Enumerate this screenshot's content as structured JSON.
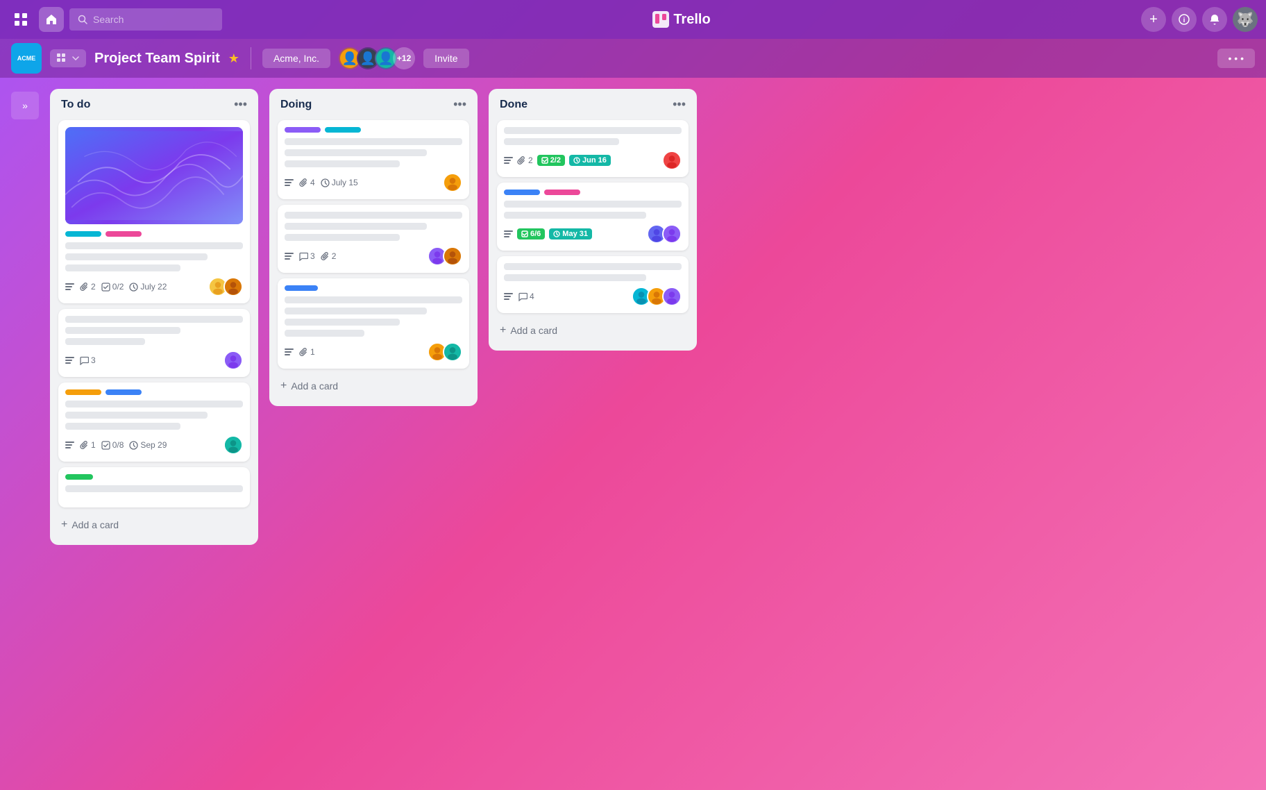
{
  "app": {
    "title": "Trello"
  },
  "nav": {
    "search_placeholder": "Search",
    "home_icon": "🏠",
    "grid_icon": "⊞",
    "plus_icon": "+",
    "info_icon": "ℹ",
    "bell_icon": "🔔",
    "avatar_icon": "🐺"
  },
  "board": {
    "workspace_logo": "ACME",
    "title": "Project Team Spirit",
    "workspace_name": "Acme, Inc.",
    "members_extra": "+12",
    "invite_label": "Invite",
    "more_label": "• • •"
  },
  "columns": [
    {
      "id": "todo",
      "title": "To do",
      "cards": [
        {
          "id": "card-1",
          "has_cover": true,
          "tags": [
            "cyan",
            "pink"
          ],
          "lines": [
            "full",
            "long",
            "med"
          ],
          "meta": {
            "has_desc": true,
            "attachments": "2",
            "checklist": "0/2",
            "due": "July 22"
          },
          "avatars": [
            "person1",
            "person2"
          ]
        },
        {
          "id": "card-2",
          "has_cover": false,
          "tags": [],
          "lines": [
            "full",
            "med",
            "short"
          ],
          "meta": {
            "has_desc": true,
            "comments": "3"
          },
          "avatars": [
            "person3"
          ]
        },
        {
          "id": "card-3",
          "has_cover": false,
          "tags": [
            "yellow",
            "blue"
          ],
          "lines": [
            "full",
            "long",
            "med"
          ],
          "meta": {
            "has_desc": true,
            "attachments": "1",
            "checklist": "0/8",
            "due": "Sep 29"
          },
          "avatars": [
            "person4"
          ]
        },
        {
          "id": "card-4",
          "has_cover": false,
          "tags": [
            "green"
          ],
          "lines": [
            "full"
          ],
          "meta": {},
          "avatars": []
        }
      ]
    },
    {
      "id": "doing",
      "title": "Doing",
      "cards": [
        {
          "id": "card-5",
          "has_cover": false,
          "tags": [
            "purple",
            "cyan"
          ],
          "lines": [
            "full",
            "long",
            "med"
          ],
          "meta": {
            "has_desc": true,
            "attachments": "4",
            "due": "July 15"
          },
          "avatars": [
            "person5"
          ]
        },
        {
          "id": "card-6",
          "has_cover": false,
          "tags": [],
          "lines": [
            "full",
            "long",
            "med"
          ],
          "meta": {
            "has_desc": true,
            "comments": "3",
            "attachments": "2"
          },
          "avatars": [
            "person6",
            "person7"
          ]
        },
        {
          "id": "card-7",
          "has_cover": false,
          "tags": [
            "blue"
          ],
          "lines": [
            "full",
            "long",
            "med",
            "short"
          ],
          "meta": {
            "has_desc": true,
            "attachments": "1"
          },
          "avatars": [
            "person8",
            "person9"
          ]
        }
      ]
    },
    {
      "id": "done",
      "title": "Done",
      "cards": [
        {
          "id": "card-8",
          "has_cover": false,
          "tags": [],
          "lines": [
            "full",
            "med"
          ],
          "meta": {
            "has_desc": true,
            "attachments": "2",
            "checklist_badge": "2/2",
            "due_badge": "Jun 16"
          },
          "avatars": [
            "person10"
          ]
        },
        {
          "id": "card-9",
          "has_cover": false,
          "tags": [
            "blue",
            "pink"
          ],
          "lines": [
            "full",
            "long"
          ],
          "meta": {
            "has_desc": true,
            "checklist_badge": "6/6",
            "due_badge": "May 31"
          },
          "avatars": [
            "person11",
            "person12"
          ]
        },
        {
          "id": "card-10",
          "has_cover": false,
          "tags": [],
          "lines": [
            "full",
            "long"
          ],
          "meta": {
            "has_desc": true,
            "comments": "4"
          },
          "avatars": [
            "person13",
            "person14",
            "person15"
          ]
        }
      ]
    }
  ],
  "add_card_label": "+ Add a card",
  "sidebar_collapse": "»",
  "avatar_colors": {
    "person1": "#f59e0b",
    "person2": "#d97706",
    "person3": "#8b5cf6",
    "person4": "#14b8a6",
    "person5": "#f59e0b",
    "person6": "#8b5cf6",
    "person7": "#d97706",
    "person8": "#f59e0b",
    "person9": "#14b8a6",
    "person10": "#ef4444",
    "person11": "#6366f1",
    "person12": "#8b5cf6",
    "person13": "#06b6d4",
    "person14": "#f59e0b",
    "person15": "#8b5cf6"
  }
}
